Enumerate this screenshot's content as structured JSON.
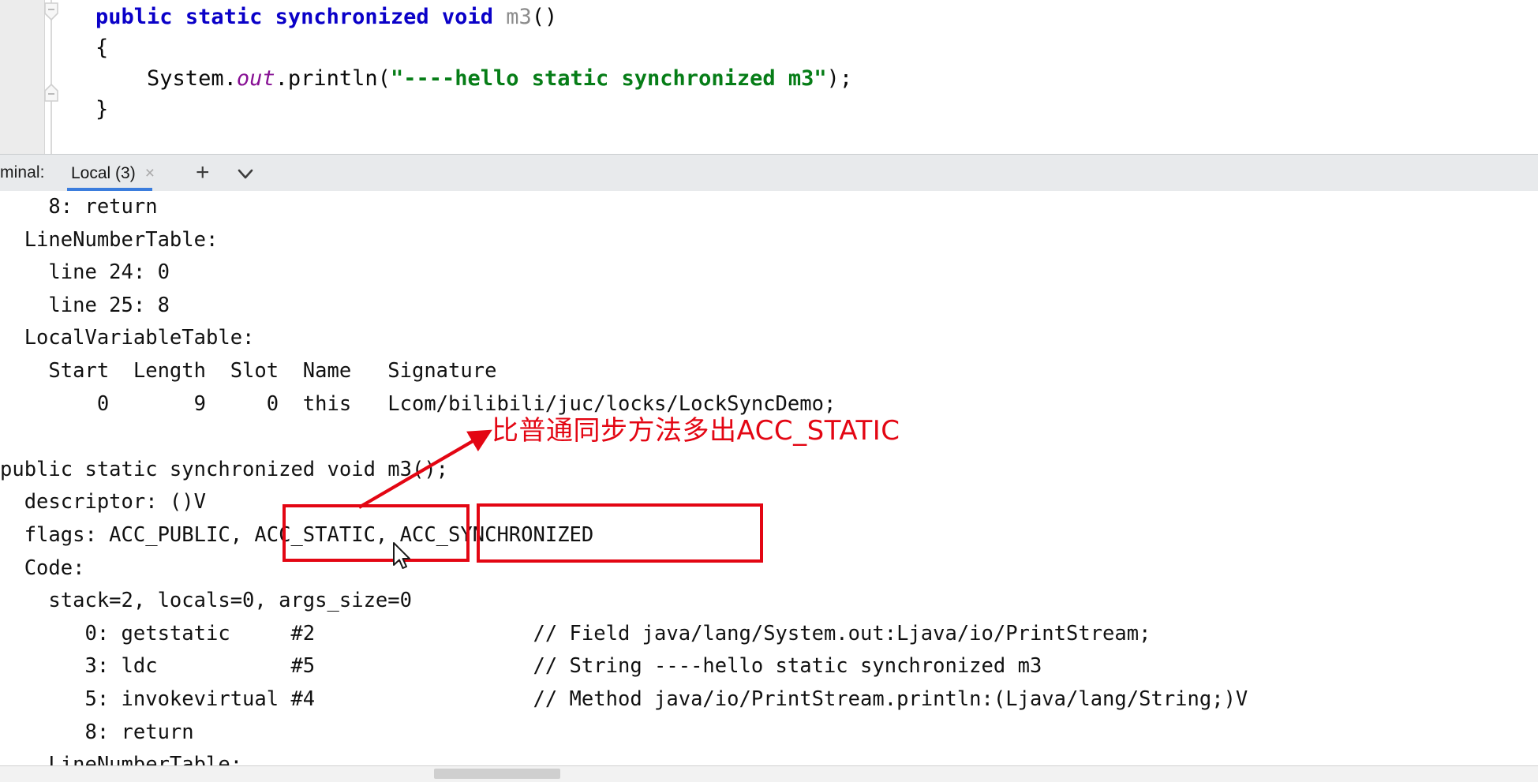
{
  "editor": {
    "language": "java",
    "lines": [
      {
        "id": "method-signature",
        "tokens": [
          {
            "text": "    ",
            "style": "plain"
          },
          {
            "text": "public static synchronized void ",
            "style": "kw"
          },
          {
            "text": "m3",
            "style": "mname"
          },
          {
            "text": "()",
            "style": "plain"
          }
        ]
      },
      {
        "id": "open-brace",
        "tokens": [
          {
            "text": "    {",
            "style": "plain"
          }
        ]
      },
      {
        "id": "println-statement",
        "tokens": [
          {
            "text": "        System.",
            "style": "plain"
          },
          {
            "text": "out",
            "style": "field-it"
          },
          {
            "text": ".println(",
            "style": "plain"
          },
          {
            "text": "\"----hello static synchronized m3\"",
            "style": "str"
          },
          {
            "text": ");",
            "style": "plain"
          }
        ]
      },
      {
        "id": "close-brace",
        "tokens": [
          {
            "text": "    }",
            "style": "plain"
          }
        ]
      }
    ],
    "fold_markers": [
      "collapse-fold-icon",
      "collapse-fold-icon"
    ]
  },
  "terminal_bar": {
    "label": "minal:",
    "full_label": "Terminal:",
    "tab_label": "Local (3)",
    "tab_close_glyph": "×",
    "add_glyph": "+",
    "dropdown_icon": "chevron-down-icon",
    "active_tab_color": "#3b7ddd"
  },
  "terminal_output": {
    "lines": [
      "    8: return",
      "  LineNumberTable:",
      "    line 24: 0",
      "    line 25: 8",
      "  LocalVariableTable:",
      "    Start  Length  Slot  Name   Signature",
      "        0       9     0  this   Lcom/bilibili/juc/locks/LockSyncDemo;",
      "",
      "public static synchronized void m3();",
      "  descriptor: ()V",
      "  flags: ACC_PUBLIC, ACC_STATIC, ACC_SYNCHRONIZED",
      "  Code:",
      "    stack=2, locals=0, args_size=0",
      "       0: getstatic     #2                  // Field java/lang/System.out:Ljava/io/PrintStream;",
      "       3: ldc           #5                  // String ----hello static synchronized m3",
      "       5: invokevirtual #4                  // Method java/io/PrintStream.println:(Ljava/lang/String;)V",
      "       8: return",
      "    LineNumberTable:"
    ]
  },
  "annotations": {
    "note_text": "比普通同步方法多出ACC_STATIC",
    "highlight_color": "#e30613",
    "boxes": [
      {
        "name": "acc-static-highlight",
        "label": "ACC_STATIC,"
      },
      {
        "name": "acc-synchronized-highlight",
        "label": "ACC_SYNCHRONIZED"
      }
    ],
    "arrow": "red-arrow-pointing-to-acc-static",
    "cursor": "mouse-pointer-icon"
  }
}
